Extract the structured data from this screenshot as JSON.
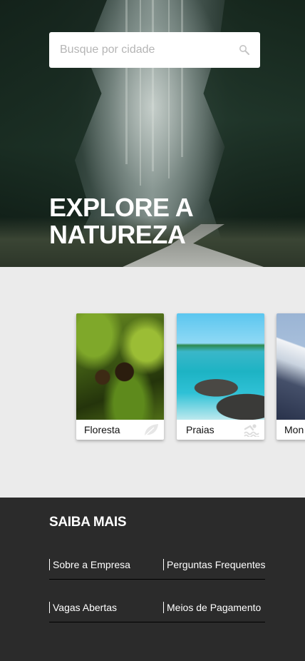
{
  "search": {
    "placeholder": "Busque por cidade",
    "icon": "search-icon"
  },
  "hero": {
    "title_line1": "EXPLORE A",
    "title_line2": "NATUREZA"
  },
  "categories": [
    {
      "label": "Floresta",
      "icon": "leaf-icon"
    },
    {
      "label": "Praias",
      "icon": "swimmer-icon"
    },
    {
      "label": "Mon",
      "icon": "mountain-icon"
    }
  ],
  "footer": {
    "title": "SAIBA MAIS",
    "links": [
      "Sobre a Empresa",
      "Perguntas Frequentes",
      "Vagas Abertas",
      "Meios de Pagamento"
    ]
  },
  "colors": {
    "footer_bg": "#2b2b2b",
    "categories_bg": "#ebebeb",
    "hero_text": "#ffffff"
  }
}
